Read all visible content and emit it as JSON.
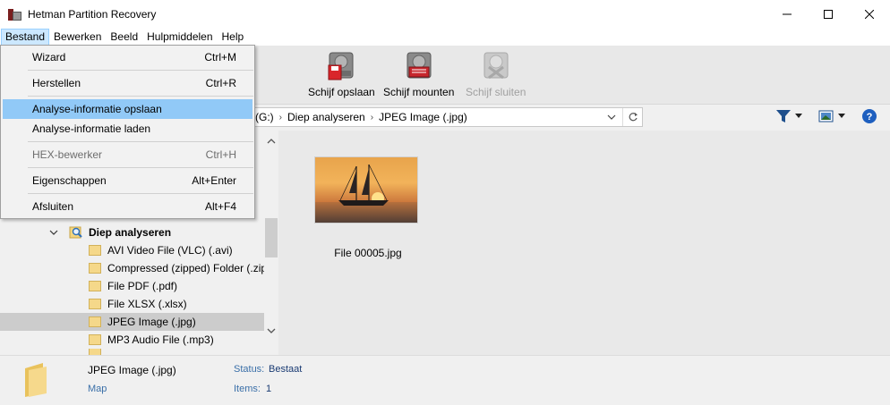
{
  "window": {
    "title": "Hetman Partition Recovery"
  },
  "menubar": {
    "items": [
      "Bestand",
      "Bewerken",
      "Beeld",
      "Hulpmiddelen",
      "Help"
    ]
  },
  "dropdown": {
    "items": [
      {
        "label": "Wizard",
        "shortcut": "Ctrl+M"
      },
      {
        "label": "Herstellen",
        "shortcut": "Ctrl+R"
      },
      {
        "label": "Analyse-informatie opslaan",
        "shortcut": ""
      },
      {
        "label": "Analyse-informatie laden",
        "shortcut": ""
      },
      {
        "label": "HEX-bewerker",
        "shortcut": "Ctrl+H"
      },
      {
        "label": "Eigenschappen",
        "shortcut": "Alt+Enter"
      },
      {
        "label": "Afsluiten",
        "shortcut": "Alt+F4"
      }
    ]
  },
  "toolbar": {
    "save_disk": "Schijf opslaan",
    "mount_disk": "Schijf mounten",
    "close_disk": "Schijf sluiten"
  },
  "address": {
    "drive": "(G:)",
    "deep": "Diep analyseren",
    "current": "JPEG Image (.jpg)"
  },
  "tree": {
    "root": "Diep analyseren",
    "items": [
      "AVI Video File (VLC) (.avi)",
      "Compressed (zipped) Folder (.zip)",
      "File PDF (.pdf)",
      "File XLSX (.xlsx)",
      "JPEG Image (.jpg)",
      "MP3 Audio File (.mp3)"
    ]
  },
  "content": {
    "file_name": "File 00005.jpg"
  },
  "status": {
    "name": "JPEG Image (.jpg)",
    "type": "Map",
    "status_key": "Status:",
    "status_value": "Bestaat",
    "items_key": "Items:",
    "items_value": "1"
  },
  "colors": {
    "menu_highlight": "#91c9f7",
    "selected_row": "#cccccc",
    "status_label": "#3a6fa8"
  }
}
